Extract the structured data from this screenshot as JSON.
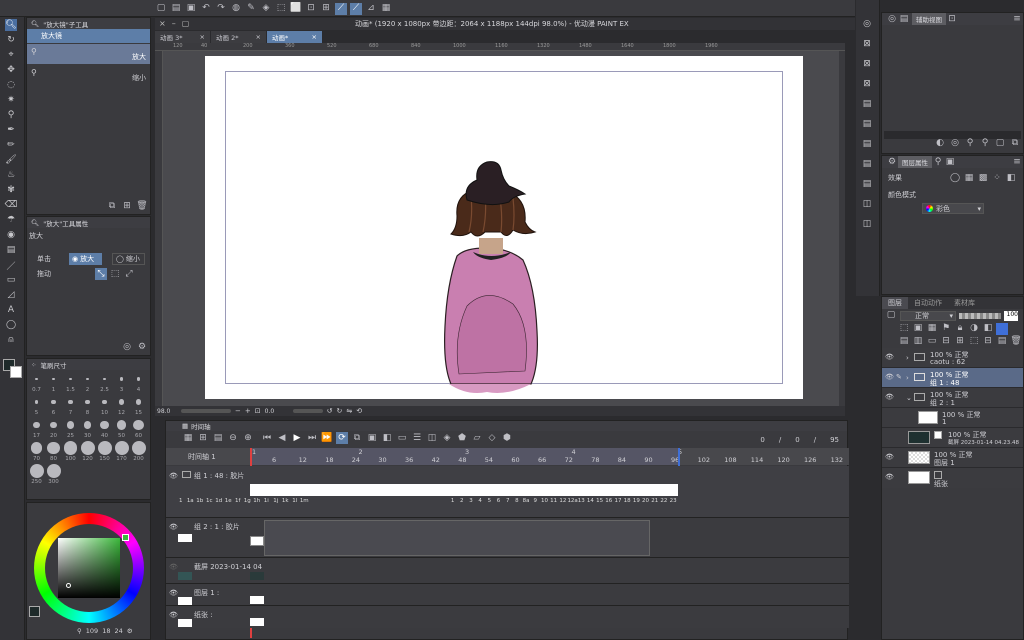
{
  "title": "动画* (1920 x 1080px 带边距：2064 x 1188px 144dpi 98.0%) - 优动漫 PAINT EX",
  "doc_tabs": [
    "动画 3*",
    "动画 2*",
    "动画*"
  ],
  "ruler_ticks": [
    "120",
    "40",
    "200",
    "360",
    "520",
    "680",
    "840",
    "1000",
    "1160",
    "1320",
    "1480",
    "1640",
    "1800",
    "1960"
  ],
  "zoom_value": "98.0",
  "rotate_value": "0.0",
  "sub_tool_panel": {
    "title": "\"放大镜\"子工具",
    "items": [
      "放大镜",
      "放大",
      "缩小"
    ]
  },
  "tool_prop_panel": {
    "title": "\"放大\"工具属性",
    "name": "放大",
    "click_label": "单击",
    "drag_label": "拖动",
    "zoom_in": "放大",
    "zoom_out": "缩小"
  },
  "brush_size_panel": {
    "title": "笔刷尺寸",
    "sizes": [
      "0.7",
      "1",
      "1.5",
      "2",
      "2.5",
      "3",
      "4",
      "5",
      "6",
      "7",
      "8",
      "10",
      "12",
      "15",
      "17",
      "20",
      "25",
      "30",
      "40",
      "50",
      "60",
      "70",
      "80",
      "100",
      "120",
      "150",
      "170",
      "200",
      "250",
      "300"
    ]
  },
  "color_values": {
    "r": "109",
    "g": "18",
    "b": "24"
  },
  "colors": {
    "accent": "#5d7ea8",
    "bg": "#2b2b2e",
    "panel": "#3a3a3e",
    "dress": "#c97fb0",
    "hair": "#3d2418",
    "hat": "#2a1f24"
  },
  "timeline": {
    "title": "时间轴",
    "name": "时间轴 1",
    "frame_current": "0",
    "frame_sep1": "/",
    "frame_mid": "0",
    "frame_sep2": "/",
    "frame_total": "95",
    "frame_numbers": [
      "6",
      "12",
      "18",
      "24",
      "30",
      "36",
      "42",
      "48",
      "54",
      "60",
      "66",
      "72",
      "78",
      "84",
      "90",
      "96",
      "102",
      "108",
      "114",
      "120",
      "126",
      "132"
    ],
    "sec_marks": [
      "1",
      "2",
      "3",
      "4",
      "5"
    ],
    "tracks": [
      {
        "name": "组 1 : 48 : 胶片"
      },
      {
        "name": "组 2 : 1 : 胶片"
      },
      {
        "name": "截屏 2023-01-14 04"
      },
      {
        "name": "图层 1 :"
      },
      {
        "name": "纸张 :"
      }
    ],
    "cell_labels_left": [
      "1",
      "1a",
      "1b",
      "1c",
      "1d",
      "1e",
      "1f",
      "1g",
      "1h",
      "1i",
      "1j",
      "1k",
      "1l",
      "1m"
    ],
    "cell_labels_right": [
      "1",
      "2",
      "3",
      "4",
      "5",
      "6",
      "7",
      "8",
      "8a",
      "9",
      "10",
      "11",
      "12",
      "12a",
      "13",
      "14",
      "15",
      "16",
      "17",
      "18",
      "19",
      "20",
      "21",
      "22",
      "23"
    ]
  },
  "sub_view_panel": {
    "title": "辅助视图"
  },
  "layer_prop_panel": {
    "title": "图层属性",
    "effect_label": "效果",
    "color_mode_label": "颜色模式",
    "color_mode_value": "彩色"
  },
  "layer_panel": {
    "tabs": [
      "图层",
      "自动动作",
      "素材库"
    ],
    "blend_mode": "正常",
    "opacity": "100",
    "layers": [
      {
        "pct": "100 % 正常",
        "name": "caotu : 62"
      },
      {
        "pct": "100 % 正常",
        "name": "组 1 : 48"
      },
      {
        "pct": "100 % 正常",
        "name": "组 2 : 1"
      },
      {
        "pct": "100 % 正常",
        "name": "1"
      },
      {
        "pct": "100 % 正常",
        "name": "截屏 2023-01-14 04.23.48"
      },
      {
        "pct": "100 % 正常",
        "name": "图层 1"
      },
      {
        "pct": "",
        "name": "纸张"
      }
    ]
  }
}
